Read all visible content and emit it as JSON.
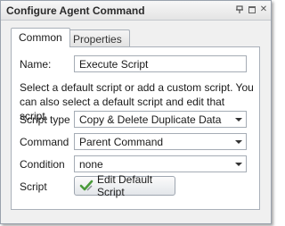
{
  "window": {
    "title": "Configure Agent Command"
  },
  "tabs": [
    {
      "label": "Common"
    },
    {
      "label": "Properties"
    }
  ],
  "form": {
    "name_label": "Name:",
    "name_value": "Execute Script",
    "description": "Select a default script or add a custom script. You can also select a default script and edit that script.",
    "script_type_label": "Script type",
    "script_type_value": "Copy & Delete Duplicate Data",
    "command_label": "Command",
    "command_value": "Parent Command",
    "condition_label": "Condition",
    "condition_value": "none",
    "script_label": "Script",
    "edit_button_label": "Edit Default Script"
  },
  "icons": {
    "pin": "pin-icon",
    "maximize": "maximize-icon",
    "close": "close-icon",
    "edit": "checkmark-pencil-icon"
  },
  "colors": {
    "edit_icon": "#4a9a3a"
  }
}
